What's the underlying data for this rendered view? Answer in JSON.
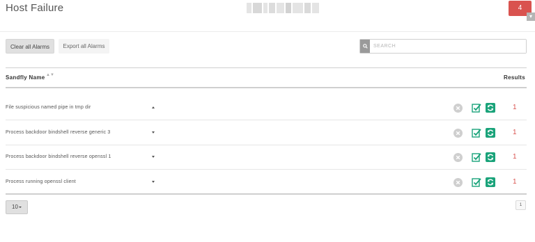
{
  "page": {
    "title": "Host Failure",
    "alert_count": "4",
    "corner_tab_icon": "chevron-icon"
  },
  "toolbar": {
    "clear_label": "Clear all Alarms",
    "export_label": "Export all Alarms"
  },
  "search": {
    "placeholder": "SEARCH",
    "value": ""
  },
  "table": {
    "columns": {
      "name": "Sandfly Name",
      "results": "Results"
    },
    "rows": [
      {
        "name": "File suspicious named pipe in tmp dir",
        "caret": "up",
        "result": "1"
      },
      {
        "name": "Process backdoor bindshell reverse generic 3",
        "caret": "down",
        "result": "1"
      },
      {
        "name": "Process backdoor bindshell reverse openssl 1",
        "caret": "down",
        "result": "1"
      },
      {
        "name": "Process running openssl client",
        "caret": "down",
        "result": "1"
      }
    ]
  },
  "pagination": {
    "per_page": "10",
    "current_page": "1"
  },
  "colors": {
    "badge": "#d9534f",
    "result": "#d9534f",
    "action_green": "#1aa37a",
    "action_gray": "#cfcfcf"
  }
}
